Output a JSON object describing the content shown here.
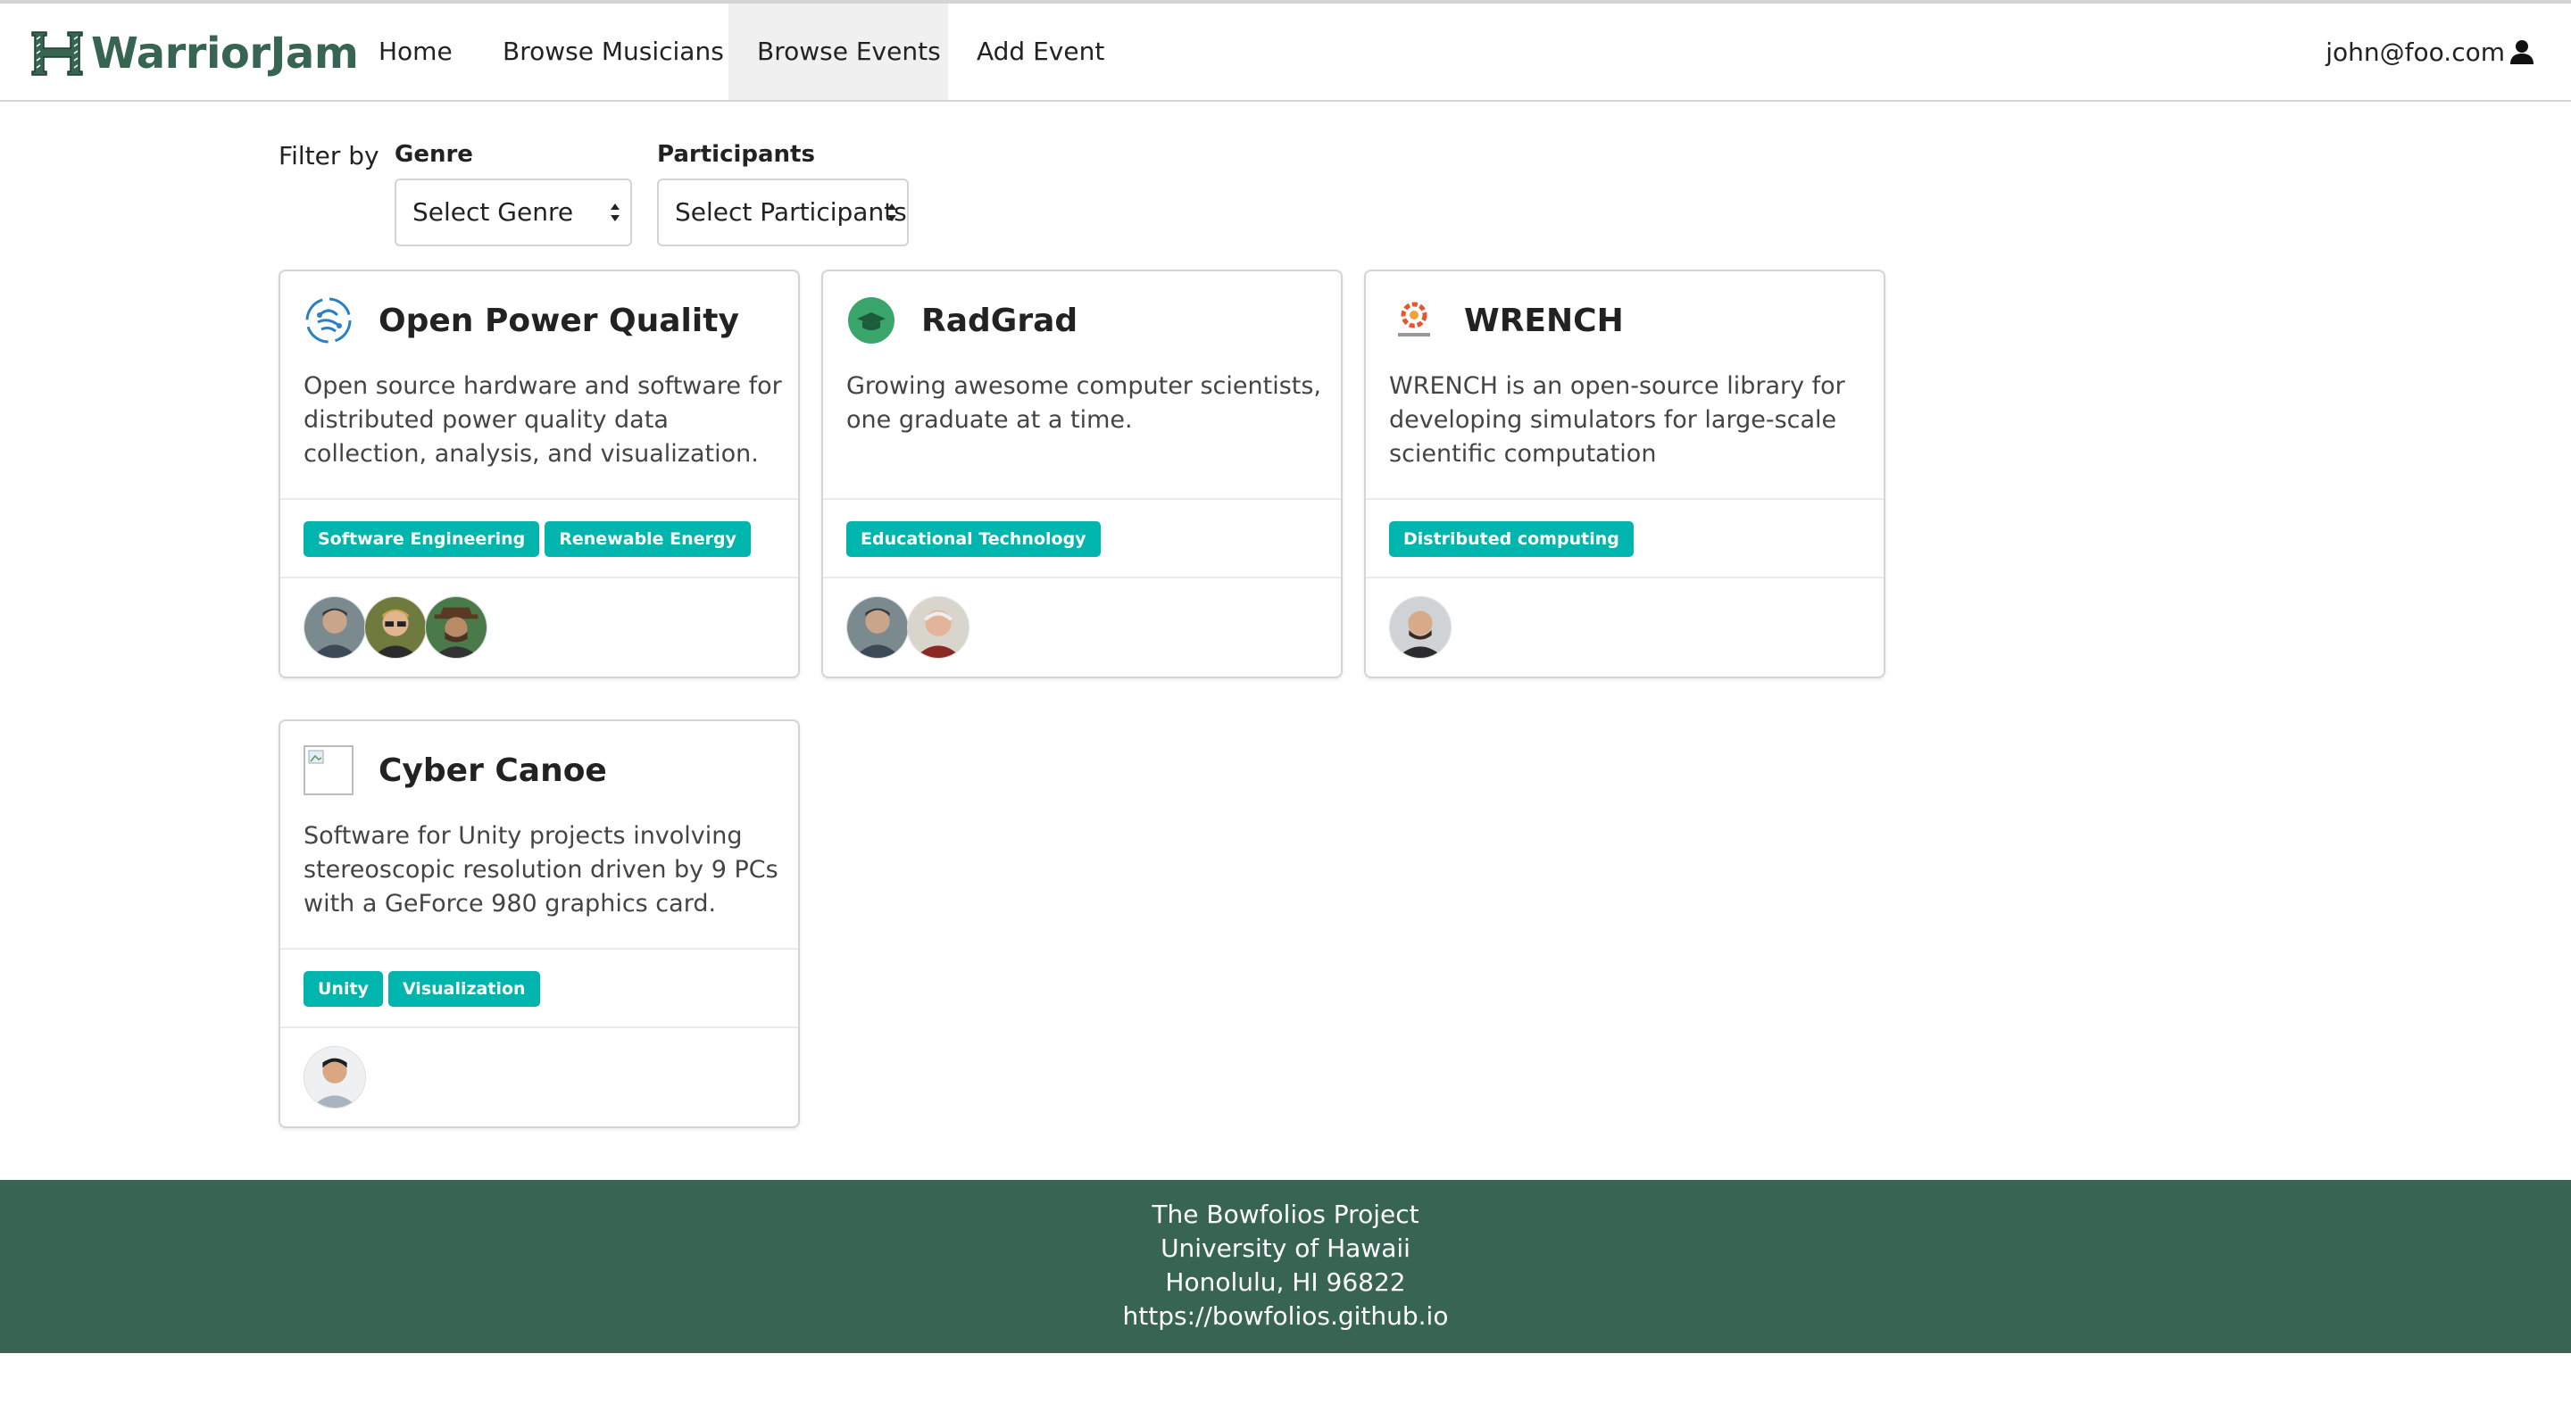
{
  "navbar": {
    "brand": "WarriorJam",
    "items": [
      {
        "label": "Home"
      },
      {
        "label": "Browse Musicians"
      },
      {
        "label": "Browse Events",
        "active": true
      },
      {
        "label": "Add Event"
      }
    ],
    "user": "john@foo.com",
    "colors": {
      "brand": "#376551",
      "active_bg": "#f0f0f0"
    }
  },
  "filter": {
    "label": "Filter by",
    "genre": {
      "label": "Genre",
      "value": "Select Genre"
    },
    "participants": {
      "label": "Participants",
      "value": "Select Participants"
    }
  },
  "cards": [
    {
      "title": "Open Power Quality",
      "logo": "opq-logo-icon",
      "description": "Open source hardware and software for distributed power quality data collection, analysis, and visualization.",
      "tags": [
        "Software Engineering",
        "Renewable Energy"
      ],
      "participants": 3
    },
    {
      "title": "RadGrad",
      "logo": "radgrad-logo-icon",
      "description": "Growing awesome computer scientists, one graduate at a time.",
      "tags": [
        "Educational Technology"
      ],
      "participants": 2
    },
    {
      "title": "WRENCH",
      "logo": "wrench-logo-icon",
      "description": "WRENCH is an open-source library for developing simulators for large-scale scientific computation",
      "tags": [
        "Distributed computing"
      ],
      "participants": 1
    },
    {
      "title": "Cyber Canoe",
      "logo": "broken-image-icon",
      "description": "Software for Unity projects involving stereoscopic resolution driven by 9 PCs with a GeForce 980 graphics card.",
      "tags": [
        "Unity",
        "Visualization"
      ],
      "participants": 1
    }
  ],
  "tag_color": "#00b5ad",
  "footer": {
    "line1": "The Bowfolios Project",
    "line2": "University of Hawaii",
    "line3": "Honolulu, HI 96822",
    "line4": "https://bowfolios.github.io"
  }
}
